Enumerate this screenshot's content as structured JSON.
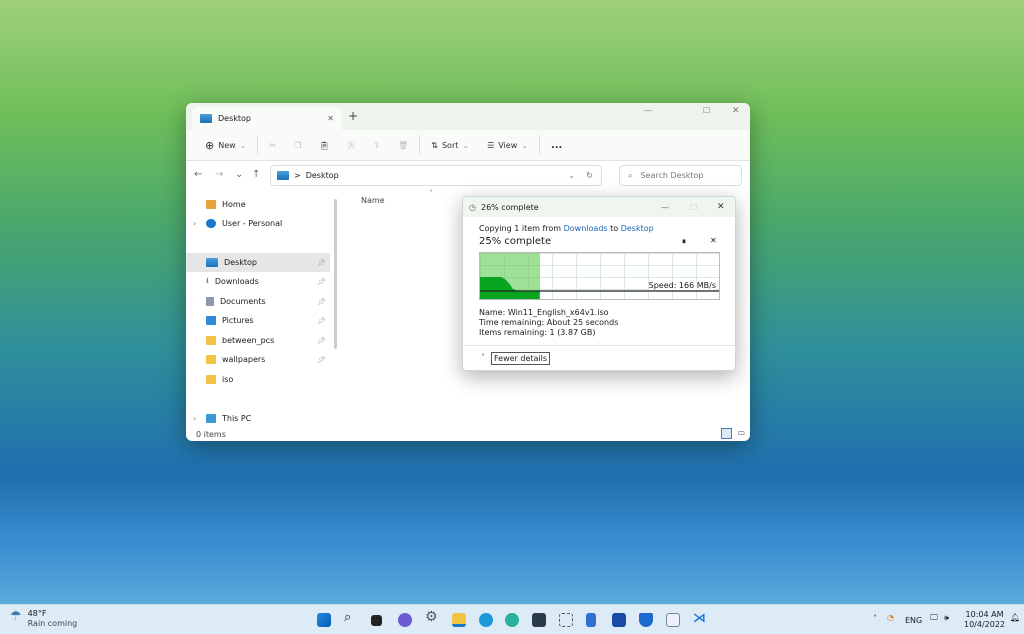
{
  "explorer": {
    "tab_title": "Desktop",
    "toolbar": {
      "new": "New",
      "sort": "Sort",
      "view": "View",
      "more": "..."
    },
    "address": {
      "crumb": "Desktop",
      "separator": ">"
    },
    "search_placeholder": "Search Desktop",
    "column_name": "Name",
    "sidebar": [
      {
        "label": "Home",
        "icon": "home-icon"
      },
      {
        "label": "User - Personal",
        "icon": "onedrive-icon"
      },
      {
        "label": "Desktop",
        "icon": "desktop-folder-icon",
        "pinned": true,
        "selected": true
      },
      {
        "label": "Downloads",
        "icon": "download-icon",
        "pinned": true
      },
      {
        "label": "Documents",
        "icon": "documents-icon",
        "pinned": true
      },
      {
        "label": "Pictures",
        "icon": "pictures-icon",
        "pinned": true
      },
      {
        "label": "between_pcs",
        "icon": "folder-icon",
        "pinned": true
      },
      {
        "label": "wallpapers",
        "icon": "folder-icon",
        "pinned": true
      },
      {
        "label": "iso",
        "icon": "folder-icon"
      },
      {
        "label": "This PC",
        "icon": "pc-icon"
      }
    ],
    "status": "0 items"
  },
  "copy_dialog": {
    "title": "26% complete",
    "copying_prefix": "Copying 1 item from",
    "source": "Downloads",
    "to": "to",
    "destination": "Desktop",
    "heading": "25% complete",
    "progress_percent": 25,
    "speed": "Speed: 166 MB/s",
    "name": "Name:  Win11_English_x64v1.iso",
    "time_remaining": "Time remaining:  About 25 seconds",
    "items_remaining": "Items remaining:  1 (3.87 GB)",
    "fewer_details": "Fewer details",
    "accent": "#06b025"
  },
  "taskbar": {
    "weather_temp": "48°F",
    "weather_desc": "Rain coming",
    "language": "ENG",
    "time": "10:04 AM",
    "date": "10/4/2022"
  }
}
